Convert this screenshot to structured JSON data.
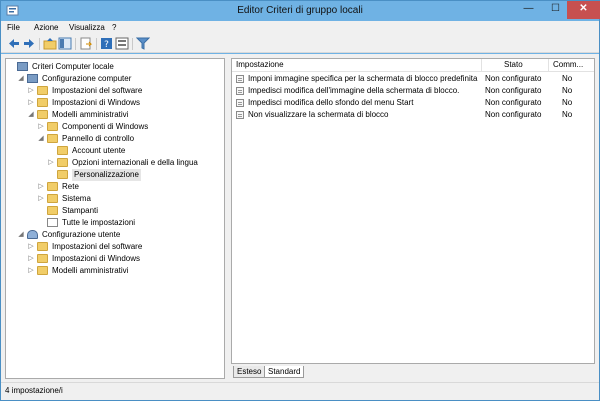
{
  "window": {
    "title": "Editor Criteri di gruppo locali",
    "close_glyph": "✕",
    "min_glyph": "—",
    "max_glyph": "☐"
  },
  "menu": [
    "File",
    "Azione",
    "Visualizza",
    "?"
  ],
  "toolbar_icons": [
    "back-arrow-icon",
    "forward-arrow-icon",
    "up-folder-icon",
    "show-hide-tree-icon",
    "export-list-icon",
    "help-icon",
    "properties-icon",
    "filter-icon"
  ],
  "tree": [
    {
      "label": "Criteri Computer locale",
      "arrow": "",
      "icon": "computer"
    },
    {
      "label": "Configurazione computer",
      "arrow": "◢",
      "icon": "computer"
    },
    {
      "label": "Impostazioni del software",
      "arrow": "▷",
      "icon": "folder"
    },
    {
      "label": "Impostazioni di Windows",
      "arrow": "▷",
      "icon": "folder"
    },
    {
      "label": "Modelli amministrativi",
      "arrow": "◢",
      "icon": "folder"
    },
    {
      "label": "Componenti di Windows",
      "arrow": "▷",
      "icon": "folder"
    },
    {
      "label": "Pannello di controllo",
      "arrow": "◢",
      "icon": "folder"
    },
    {
      "label": "Account utente",
      "arrow": "",
      "icon": "folder"
    },
    {
      "label": "Opzioni internazionali e della lingua",
      "arrow": "▷",
      "icon": "folder"
    },
    {
      "label": "Personalizzazione",
      "arrow": "",
      "icon": "folder"
    },
    {
      "label": "Rete",
      "arrow": "▷",
      "icon": "folder"
    },
    {
      "label": "Sistema",
      "arrow": "▷",
      "icon": "folder"
    },
    {
      "label": "Stampanti",
      "arrow": "",
      "icon": "folder"
    },
    {
      "label": "Tutte le impostazioni",
      "arrow": "",
      "icon": "settings"
    },
    {
      "label": "Configurazione utente",
      "arrow": "◢",
      "icon": "user"
    },
    {
      "label": "Impostazioni del software",
      "arrow": "▷",
      "icon": "folder"
    },
    {
      "label": "Impostazioni di Windows",
      "arrow": "▷",
      "icon": "folder"
    },
    {
      "label": "Modelli amministrativi",
      "arrow": "▷",
      "icon": "folder"
    }
  ],
  "list": {
    "headers": {
      "setting": "Impostazione",
      "state": "Stato",
      "comment": "Comm..."
    },
    "rows": [
      {
        "setting": "Imponi immagine specifica per la schermata di blocco predefinita",
        "state": "Non configurato",
        "comment": "No"
      },
      {
        "setting": "Impedisci modifica dell'immagine della schermata di blocco.",
        "state": "Non configurato",
        "comment": "No"
      },
      {
        "setting": "Impedisci modifica dello sfondo del menu Start",
        "state": "Non configurato",
        "comment": "No"
      },
      {
        "setting": "Non visualizzare la schermata di blocco",
        "state": "Non configurato",
        "comment": "No"
      }
    ]
  },
  "tabs": [
    "Esteso",
    "Standard"
  ],
  "status": "4 impostazione/i",
  "colors": {
    "highlight": "#fbf40e",
    "titlebar": "#6fb2e4",
    "close": "#c75050"
  }
}
